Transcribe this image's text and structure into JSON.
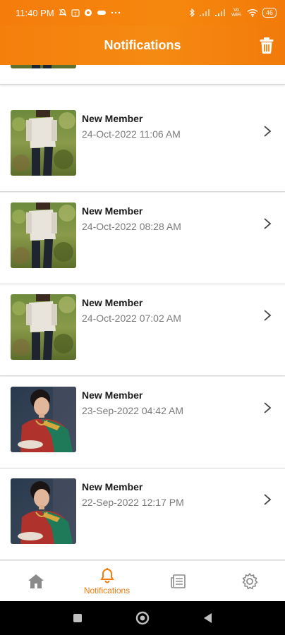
{
  "status_bar": {
    "time": "11:40 PM",
    "battery": "46",
    "wifi_label": "Vo WiFi"
  },
  "header": {
    "title": "Notifications"
  },
  "notifications": [
    {
      "title": "New Member",
      "date": "24-Oct-2022 11:06 AM",
      "photo": "man"
    },
    {
      "title": "New Member",
      "date": "24-Oct-2022 08:28 AM",
      "photo": "man"
    },
    {
      "title": "New Member",
      "date": "24-Oct-2022 07:02 AM",
      "photo": "man"
    },
    {
      "title": "New Member",
      "date": "23-Sep-2022 04:42 AM",
      "photo": "woman"
    },
    {
      "title": "New Member",
      "date": "22-Sep-2022 12:17 PM",
      "photo": "woman"
    }
  ],
  "bottom_nav": {
    "items": [
      {
        "name": "home",
        "label": ""
      },
      {
        "name": "notifications",
        "label": "Notifications",
        "active": true
      },
      {
        "name": "news",
        "label": ""
      },
      {
        "name": "settings",
        "label": ""
      }
    ]
  },
  "colors": {
    "accent": "#f5820c",
    "inactive_icon": "#8a8a8a"
  }
}
